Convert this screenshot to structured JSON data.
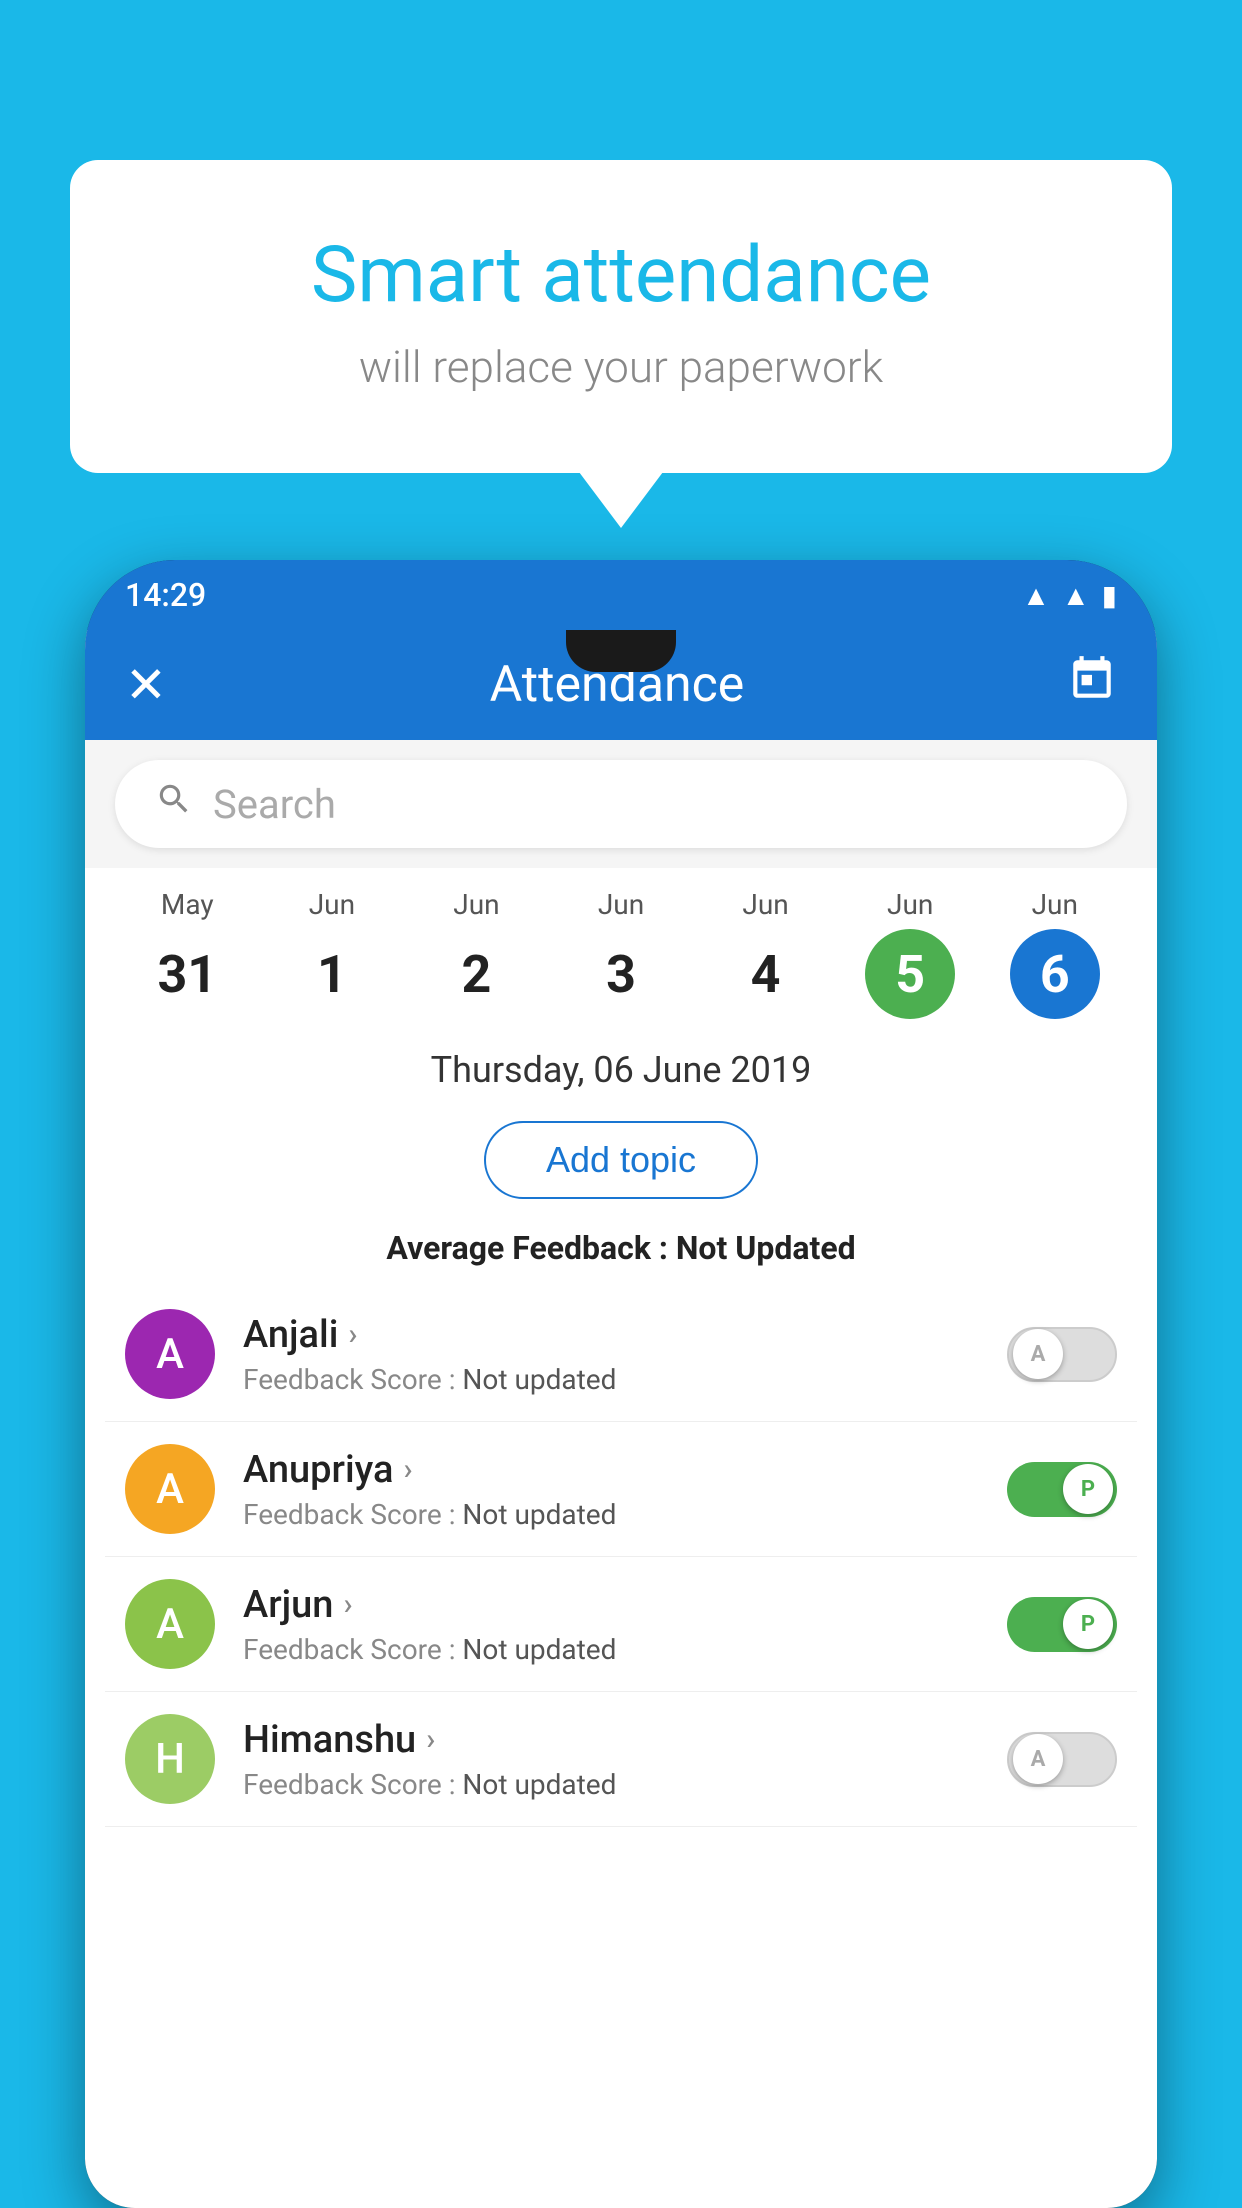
{
  "background_color": "#1ab8e8",
  "bubble": {
    "title": "Smart attendance",
    "subtitle": "will replace your paperwork"
  },
  "status_bar": {
    "time": "14:29",
    "icons": [
      "wifi",
      "signal",
      "battery"
    ]
  },
  "top_bar": {
    "title": "Attendance",
    "close_icon": "✕",
    "calendar_icon": "📅"
  },
  "search": {
    "placeholder": "Search"
  },
  "dates": [
    {
      "month": "May",
      "day": "31",
      "selected": false,
      "today": false
    },
    {
      "month": "Jun",
      "day": "1",
      "selected": false,
      "today": false
    },
    {
      "month": "Jun",
      "day": "2",
      "selected": false,
      "today": false
    },
    {
      "month": "Jun",
      "day": "3",
      "selected": false,
      "today": false
    },
    {
      "month": "Jun",
      "day": "4",
      "selected": false,
      "today": false
    },
    {
      "month": "Jun",
      "day": "5",
      "selected": true,
      "today": true
    },
    {
      "month": "Jun",
      "day": "6",
      "selected": true,
      "today": false
    }
  ],
  "selected_date_label": "Thursday, 06 June 2019",
  "add_topic_label": "Add topic",
  "feedback_summary_label": "Average Feedback : ",
  "feedback_summary_value": "Not Updated",
  "students": [
    {
      "name": "Anjali",
      "avatar_color": "#9c27b0",
      "avatar_letter": "A",
      "feedback_label": "Feedback Score : ",
      "feedback_value": "Not updated",
      "toggle_state": "off",
      "toggle_label": "A"
    },
    {
      "name": "Anupriya",
      "avatar_color": "#f5a623",
      "avatar_letter": "A",
      "feedback_label": "Feedback Score : ",
      "feedback_value": "Not updated",
      "toggle_state": "on",
      "toggle_label": "P"
    },
    {
      "name": "Arjun",
      "avatar_color": "#8bc34a",
      "avatar_letter": "A",
      "feedback_label": "Feedback Score : ",
      "feedback_value": "Not updated",
      "toggle_state": "on",
      "toggle_label": "P"
    },
    {
      "name": "Himanshu",
      "avatar_color": "#9ccc65",
      "avatar_letter": "H",
      "feedback_label": "Feedback Score : ",
      "feedback_value": "Not updated",
      "toggle_state": "off",
      "toggle_label": "A"
    }
  ]
}
